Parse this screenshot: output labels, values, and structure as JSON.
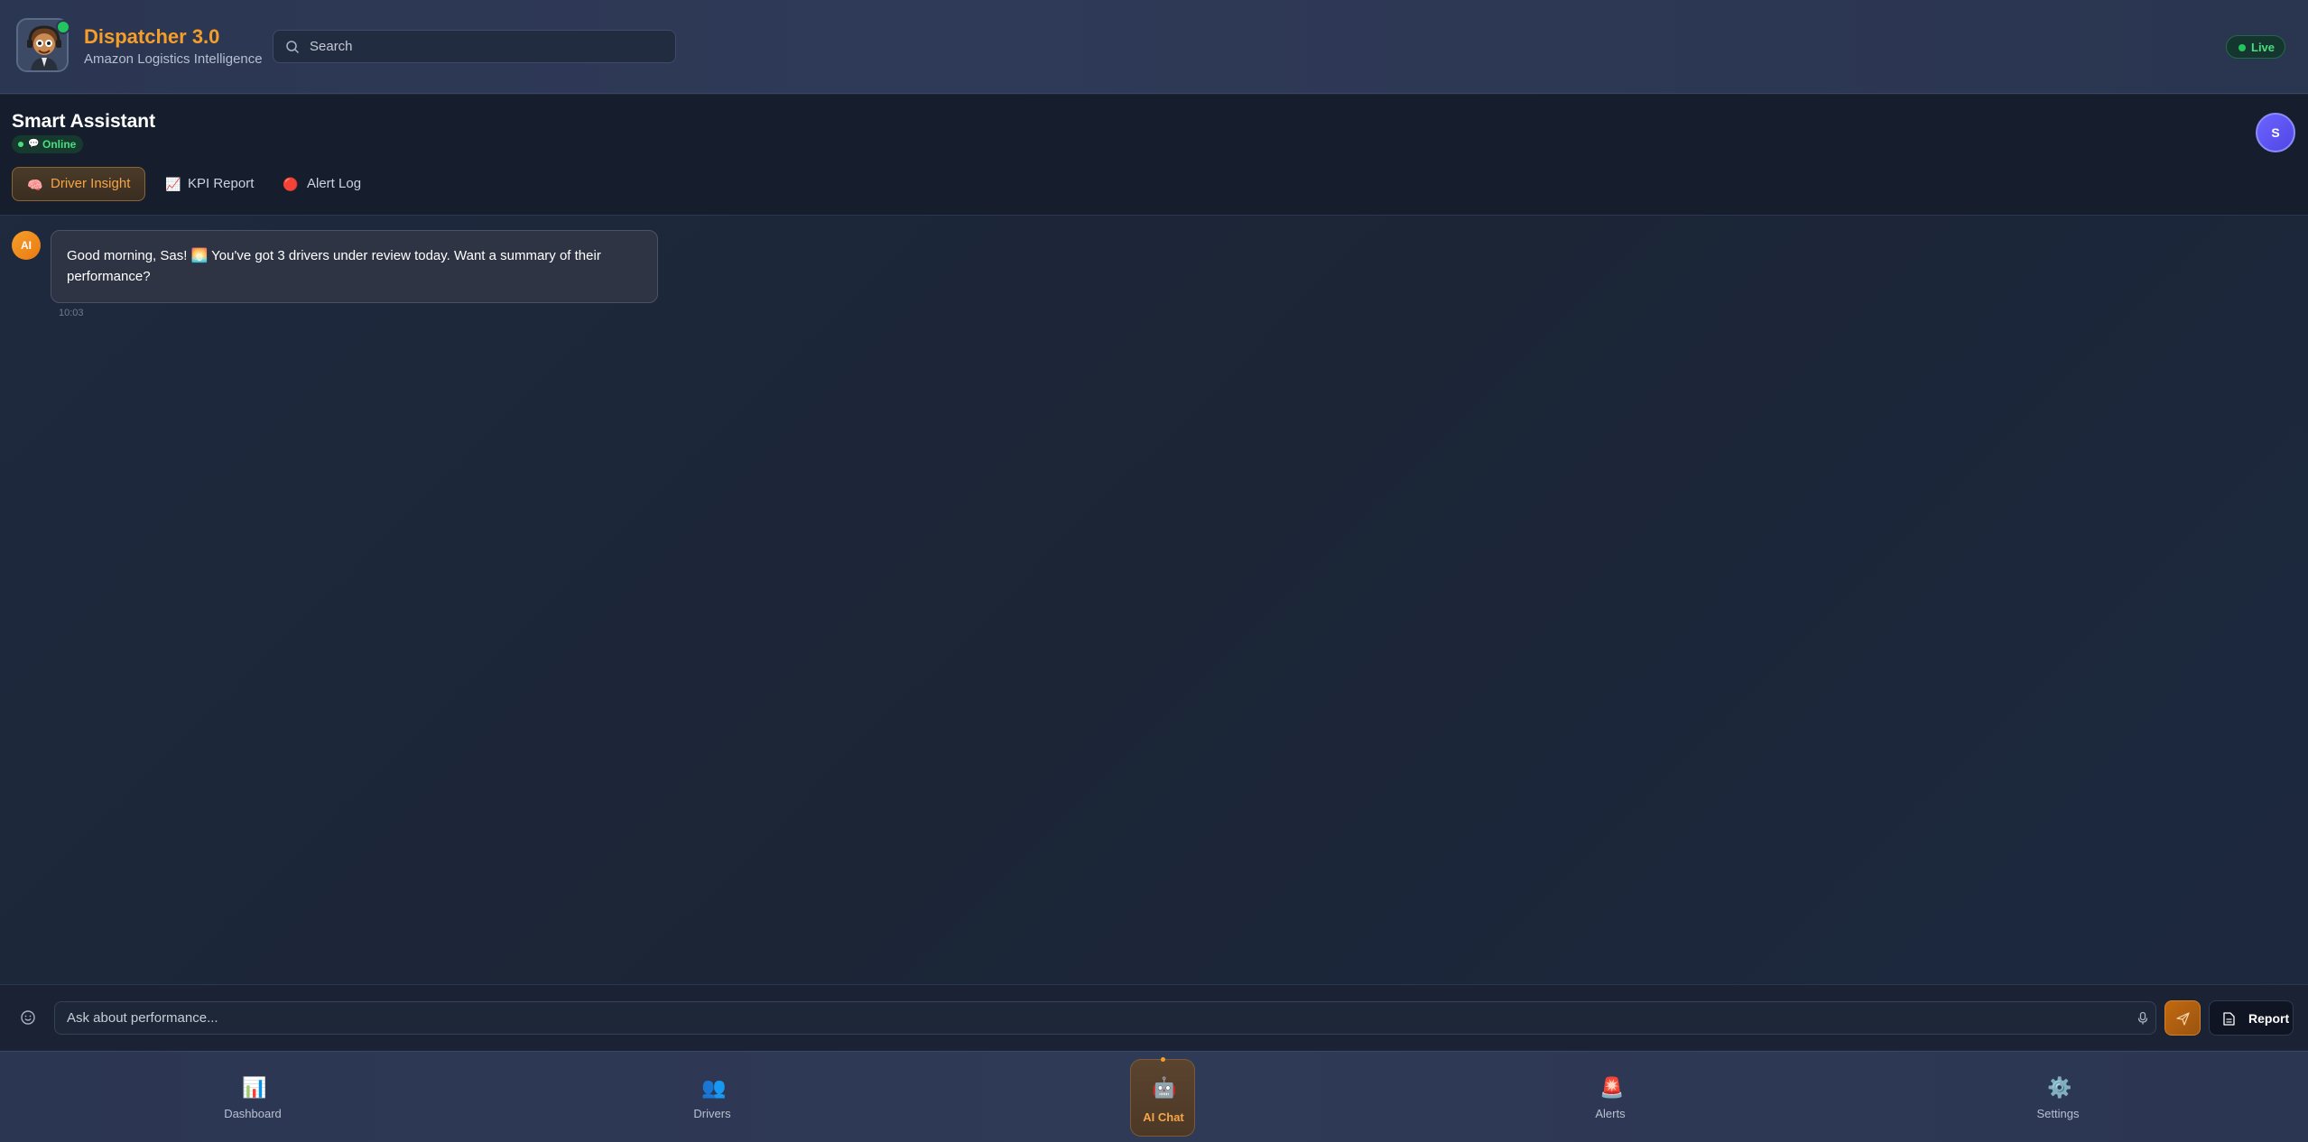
{
  "header": {
    "brand_title": "Dispatcher 3.0",
    "brand_subtitle": "Amazon Logistics Intelligence",
    "search_placeholder": "Search",
    "live_label": "Live"
  },
  "assistant": {
    "title": "Smart Assistant",
    "status": "Online",
    "user_initial": "S",
    "tabs": [
      {
        "icon": "🧠",
        "label": "Driver Insight",
        "active": true
      },
      {
        "icon": "📈",
        "label": "KPI Report",
        "active": false
      },
      {
        "icon": "🔴",
        "label": "Alert Log",
        "active": false
      }
    ]
  },
  "chat": {
    "messages": [
      {
        "sender": "AI",
        "text": "Good morning, Sas! 🌅 You've got 3 drivers under review today. Want a summary of their performance?",
        "time": "10:03"
      }
    ]
  },
  "composer": {
    "placeholder": "Ask about performance...",
    "report_label": "Report"
  },
  "nav": {
    "items": [
      {
        "icon": "📊",
        "label": "Dashboard",
        "active": false
      },
      {
        "icon": "👥",
        "label": "Drivers",
        "active": false
      },
      {
        "icon": "🤖",
        "label": "AI Chat",
        "active": true
      },
      {
        "icon": "🚨",
        "label": "Alerts",
        "active": false
      },
      {
        "icon": "⚙️",
        "label": "Settings",
        "active": false
      }
    ]
  },
  "colors": {
    "accent": "#f59e2a",
    "online": "#22c55e",
    "background": "#1c2638"
  }
}
